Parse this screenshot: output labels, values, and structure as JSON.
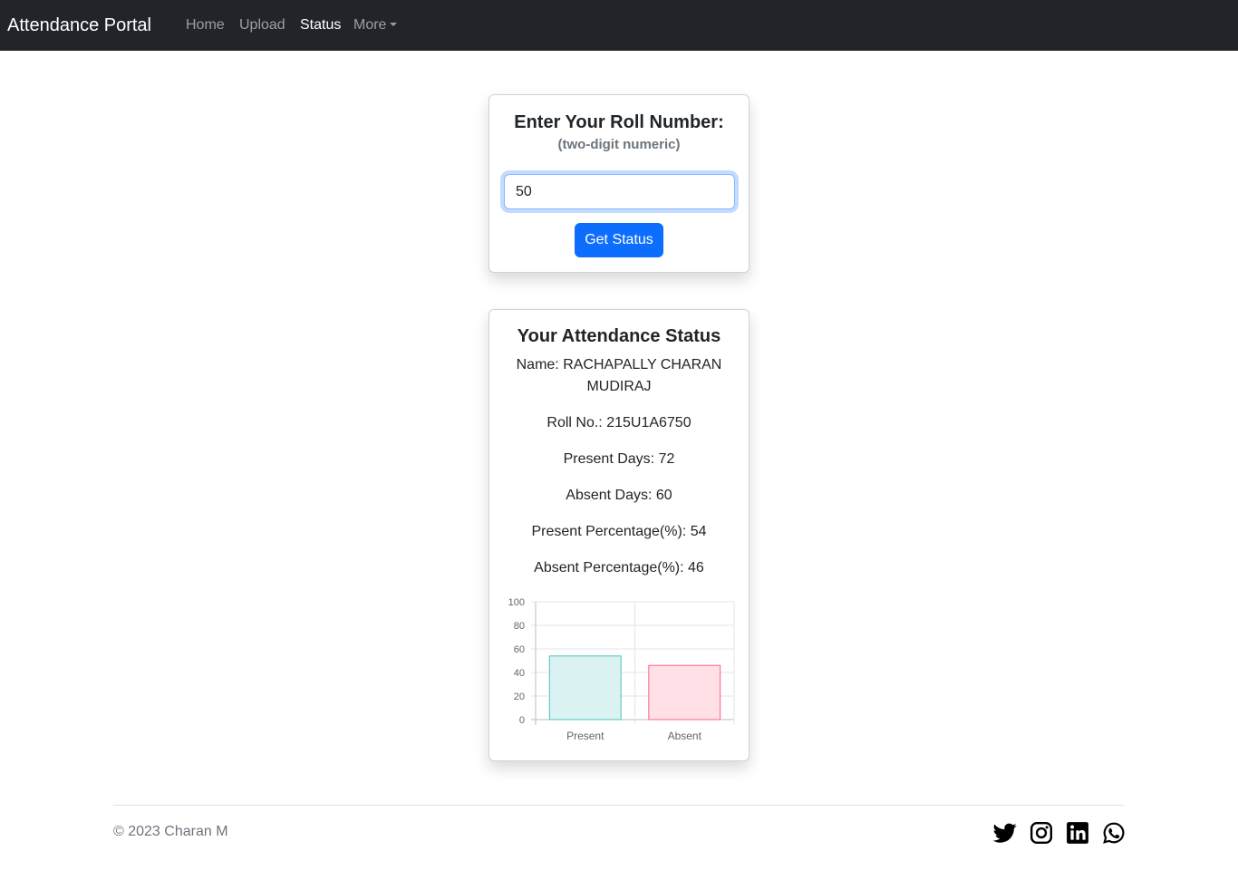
{
  "navbar": {
    "brand": "Attendance Portal",
    "links": [
      {
        "label": "Home"
      },
      {
        "label": "Upload"
      },
      {
        "label": "Status"
      },
      {
        "label": "More"
      }
    ]
  },
  "roll_form": {
    "title": "Enter Your Roll Number:",
    "subtitle": "(two-digit numeric)",
    "input_value": "50",
    "submit_label": "Get Status"
  },
  "status": {
    "title": "Your Attendance Status",
    "name_line1": "Name: RACHAPALLY CHARAN",
    "name_line2": "MUDIRAJ",
    "roll_no": "Roll No.: 215U1A6750",
    "present_days": "Present Days: 72",
    "absent_days": "Absent Days: 60",
    "present_pct": "Present Percentage(%): 54",
    "absent_pct": "Absent Percentage(%): 46"
  },
  "chart_data": {
    "type": "bar",
    "categories": [
      "Present",
      "Absent"
    ],
    "values": [
      54,
      46
    ],
    "ylim": [
      0,
      100
    ],
    "yticks": [
      0,
      20,
      40,
      60,
      80,
      100
    ],
    "grid": true,
    "colors": {
      "Present": {
        "fill": "#dbf2f2",
        "stroke": "#4bc0c0"
      },
      "Absent": {
        "fill": "#ffe0e6",
        "stroke": "#ff6384"
      }
    }
  },
  "footer": {
    "copyright": "© 2023 Charan M",
    "social_icons": [
      "twitter-icon",
      "instagram-icon",
      "linkedin-icon",
      "whatsapp-icon"
    ]
  }
}
